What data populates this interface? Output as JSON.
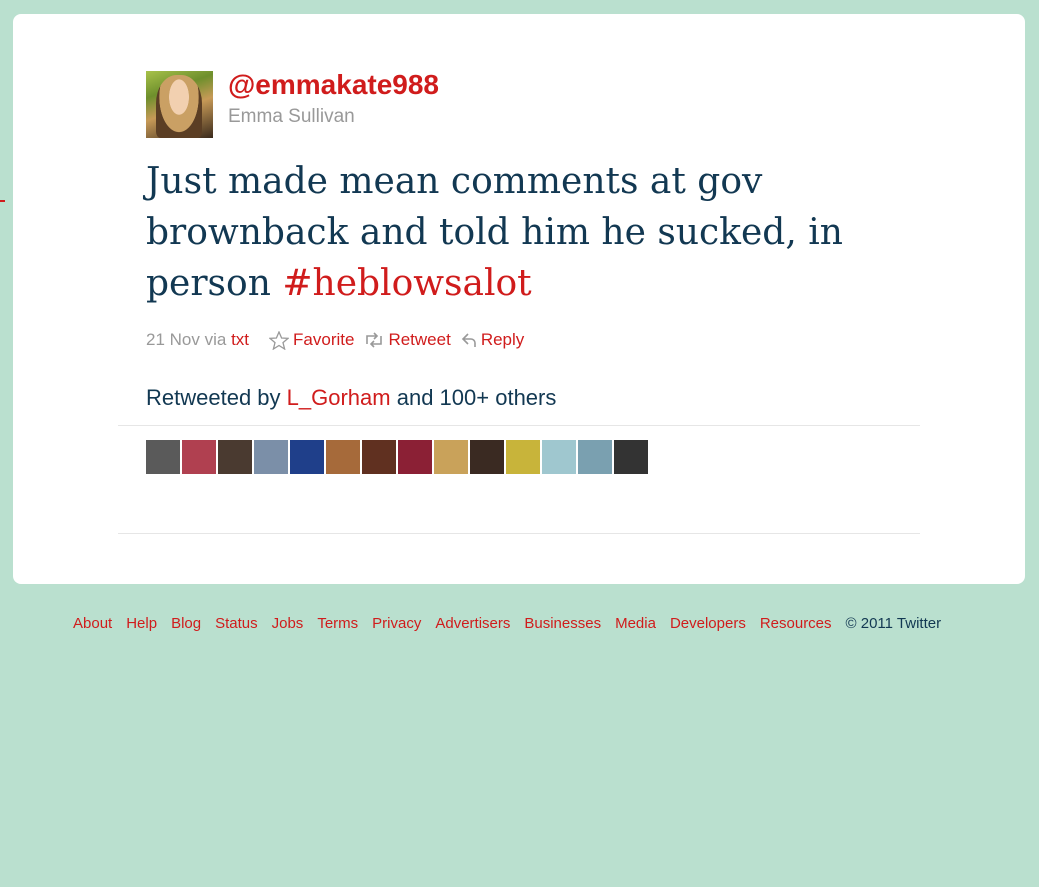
{
  "tweet": {
    "screen_name": "@emmakate988",
    "full_name": "Emma Sullivan",
    "text_plain": "Just made mean comments at gov brownback and told him he sucked, in person",
    "hashtag": "#heblowsalot",
    "date": "21 Nov",
    "via_prefix": "via",
    "via_source": "txt",
    "actions": {
      "favorite": "Favorite",
      "retweet": "Retweet",
      "reply": "Reply"
    }
  },
  "retweets": {
    "prefix": "Retweeted by",
    "user": "L_Gorham",
    "suffix": "and 100+ others",
    "avatar_colors": [
      "#5a5a5a",
      "#b04050",
      "#4a3a30",
      "#7b8fa8",
      "#1f3f8a",
      "#a66a3a",
      "#603020",
      "#8b2035",
      "#c9a25a",
      "#3a2a22",
      "#c8b43a",
      "#9fc7cf",
      "#7aa0b0",
      "#333333"
    ]
  },
  "footer": {
    "links": [
      "About",
      "Help",
      "Blog",
      "Status",
      "Jobs",
      "Terms",
      "Privacy",
      "Advertisers",
      "Businesses",
      "Media",
      "Developers",
      "Resources"
    ],
    "copyright": "© 2011 Twitter"
  },
  "colors": {
    "background": "#bae0cf",
    "link": "#d01c1c",
    "text": "#123852",
    "muted": "#999999"
  }
}
